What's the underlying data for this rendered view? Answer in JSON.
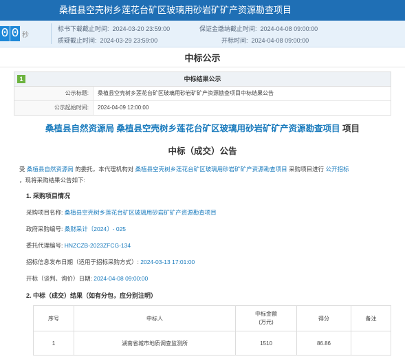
{
  "banner": {
    "title": "桑植县空壳树乡莲花台矿区玻璃用砂岩矿矿产资源勘查项目"
  },
  "countdown": {
    "d1": "0",
    "d2": "0",
    "unit": "秒"
  },
  "times": [
    {
      "label": "标书下载截止时间:",
      "value": "2024-03-20 23:59:00"
    },
    {
      "label": "保证金缴纳截止时间:",
      "value": "2024-04-08 09:00:00"
    },
    {
      "label": "质疑截止时间:",
      "value": "2024-03-29 23:59:00"
    },
    {
      "label": "开标时间:",
      "value": "2024-04-08 09:00:00"
    }
  ],
  "page_title": "中标公示",
  "panel": {
    "badge": "1",
    "head": "中标结果公示",
    "rows": [
      {
        "label": "公示标题:",
        "value": "桑植县空壳树乡莲花台矿区玻璃用砂岩矿矿产资源勘查项目中标结果公告"
      },
      {
        "label": "公示起始时间:",
        "value": "2024-04-09 12:00:00"
      }
    ]
  },
  "doc": {
    "title_blue": "桑植县自然资源局 桑植县空壳树乡莲花台矿区玻璃用砂岩矿矿产资源勘查项目",
    "title_suffix": "项目",
    "title2": "中标（成交）公告",
    "p1_a": "受",
    "p1_b": "桑植县自然资源局",
    "p1_c": "的委托，本代理机构对",
    "p1_d": "桑植县空壳树乡莲花台矿区玻璃用砂岩矿矿产资源勘查项目",
    "p1_e": "采购项目进行",
    "p1_f": "公开招标",
    "p1_g": "，现将采购结果公告如下:",
    "s1": "1. 采购项目情况",
    "l1_label": "采购项目名称:",
    "l1_value": "桑植县空壳树乡莲花台矿区玻璃用砂岩矿矿产资源勘查项目",
    "l2_label": "政府采购编号:",
    "l2_value": "桑财采计〔2024〕- 025",
    "l3_label": "委托代理编号:",
    "l3_value": "HNZCZB-2023ZFCG-134",
    "l4_label": "招标信息发布日期（适用于招标采购方式）:",
    "l4_value": "2024-03-13 17:01:00",
    "l5_label": "开标（谈判、询价）日期:",
    "l5_value": "2024-04-08 09:00:00",
    "s2": "2. 中标（成交）结果（如有分包，应分别注明）"
  },
  "table": {
    "headers": [
      "序号",
      "中标人",
      "中标金额\n(万元)",
      "得分",
      "备注"
    ],
    "rows": [
      [
        "1",
        "湖南省城市地质调查监测所",
        "1510",
        "86.86",
        ""
      ]
    ]
  }
}
